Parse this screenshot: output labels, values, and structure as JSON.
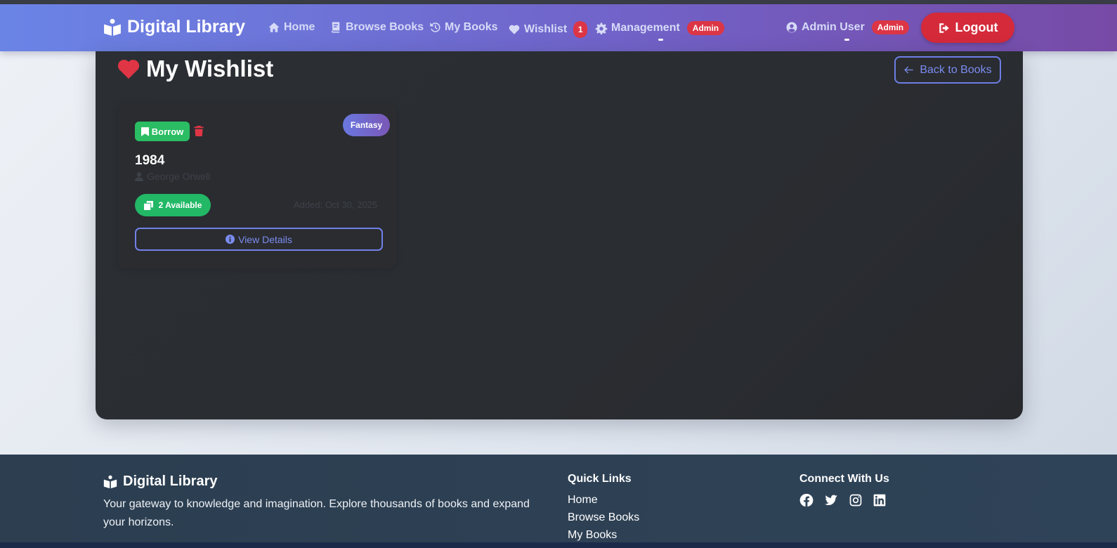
{
  "navbar": {
    "brand": "Digital Library",
    "items": [
      {
        "label": "Home",
        "icon": "home-icon"
      },
      {
        "label": "Browse Books",
        "icon": "book-icon"
      },
      {
        "label": "My Books",
        "icon": "history-icon"
      },
      {
        "label": "Wishlist",
        "icon": "heart-icon",
        "count": "1"
      },
      {
        "label": "Management",
        "icon": "gear-icon",
        "badge": "Admin"
      }
    ],
    "user": {
      "label": "Admin User",
      "badge": "Admin",
      "icon": "user-circle-icon"
    },
    "logout_label": "Logout"
  },
  "page": {
    "title": "My Wishlist",
    "back_label": "Back to Books"
  },
  "wishlist": [
    {
      "borrow_label": "Borrow",
      "genre": "Fantasy",
      "title": "1984",
      "author": "George Orwell",
      "availability": "2 Available",
      "added": "Added: Oct 30, 2025",
      "details_label": "View Details"
    }
  ],
  "footer": {
    "brand": "Digital Library",
    "description": "Your gateway to knowledge and imagination. Explore thousands of books and expand your horizons.",
    "quick_links_heading": "Quick Links",
    "quick_links": [
      "Home",
      "Browse Books",
      "My Books"
    ],
    "connect_heading": "Connect With Us",
    "social": [
      "facebook-icon",
      "twitter-icon",
      "instagram-icon",
      "linkedin-icon"
    ]
  },
  "colors": {
    "nav_gradient_start": "#6a84e6",
    "nav_gradient_end": "#774aa6",
    "danger": "#dc3545",
    "success": "#22b866",
    "accent": "#7b8cf0",
    "panel": "#2b2f34",
    "footer": "#2c3e50"
  }
}
